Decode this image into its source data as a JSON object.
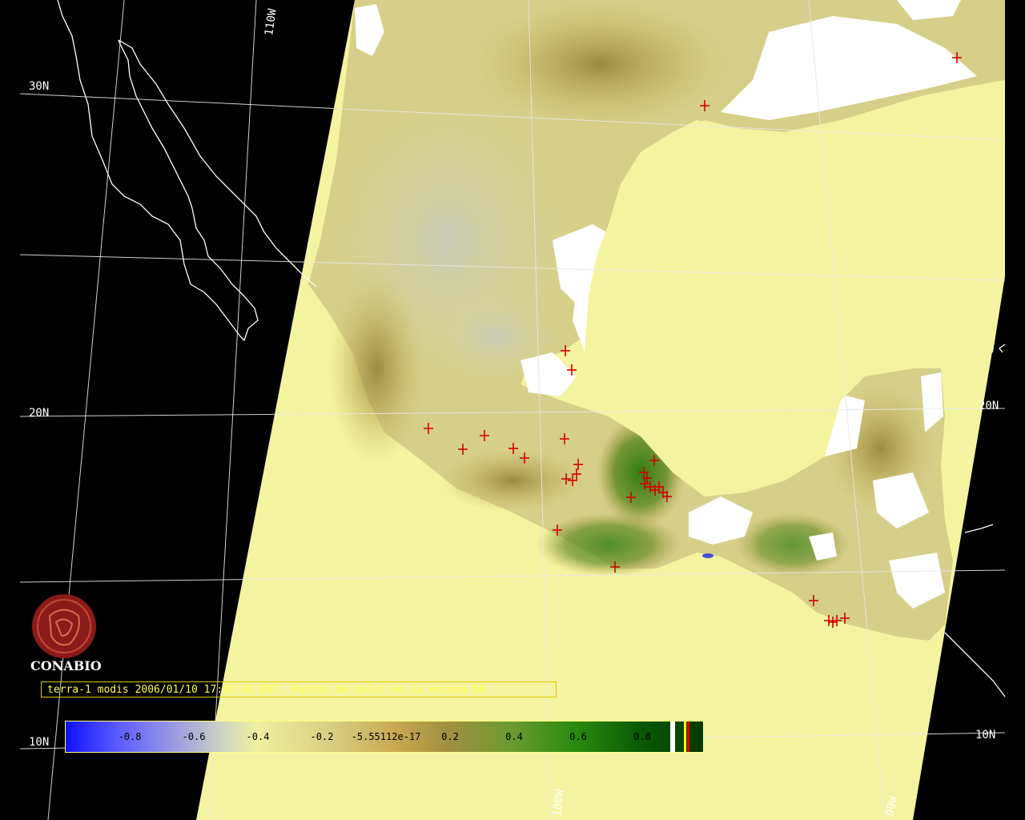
{
  "map": {
    "grid_labels": [
      "110W",
      "30N",
      "20N",
      "10N",
      "10N",
      "10N",
      "100W",
      "100W",
      "90W",
      "20N"
    ],
    "fire_count": 50
  },
  "logo": {
    "name": "CONABIO"
  },
  "caption": {
    "text": "terra-1 modis 2006/01/10 17:03:42 EVI. Puntos de calor en la escena 50"
  },
  "colorbar": {
    "ticks": [
      "-0.8",
      "-0.6",
      "-0.4",
      "-0.2",
      "-5.55112e-17",
      "0.2",
      "0.4",
      "0.6",
      "0.8"
    ]
  },
  "colors": {
    "background": "#000000",
    "scene_base": "#f4f4a0",
    "vegetation_dark": "#2e7a12",
    "vegetation_mid": "#b0a048",
    "fire_marker": "#d40000",
    "caption_text": "#ffff40",
    "logo": "#8b1a1a"
  }
}
